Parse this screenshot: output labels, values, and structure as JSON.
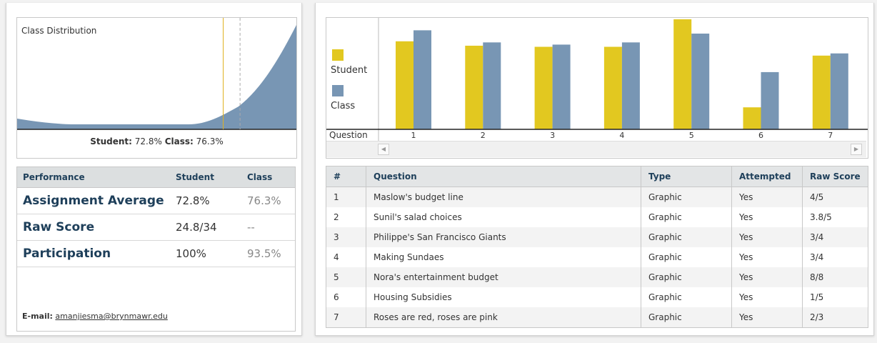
{
  "distribution": {
    "title": "Class Distribution",
    "student_label": "Student:",
    "student_value": "72.8%",
    "class_label": "Class:",
    "class_value": "76.3%",
    "student_line_pct": 72.8,
    "class_line_pct": 76.3,
    "fill_color": "#7896b4",
    "student_line_color": "#e0b020"
  },
  "performance": {
    "headers": [
      "Performance",
      "Student",
      "Class"
    ],
    "rows": [
      {
        "label": "Assignment Average",
        "student": "72.8%",
        "class": "76.3%"
      },
      {
        "label": "Raw Score",
        "student": "24.8/34",
        "class": "--"
      },
      {
        "label": "Participation",
        "student": "100%",
        "class": "93.5%"
      }
    ]
  },
  "email": {
    "label": "E-mail:",
    "address": "amanjiesma@brynmawr.edu"
  },
  "chart_data": {
    "type": "bar",
    "categories": [
      "1",
      "2",
      "3",
      "4",
      "5",
      "6",
      "7"
    ],
    "series": [
      {
        "name": "Student",
        "values": [
          0.8,
          0.76,
          0.75,
          0.75,
          1.0,
          0.2,
          0.67
        ],
        "color": "#e2c820"
      },
      {
        "name": "Class",
        "values": [
          0.9,
          0.79,
          0.77,
          0.79,
          0.87,
          0.52,
          0.69
        ],
        "color": "#7896b4"
      }
    ],
    "xlabel": "Question",
    "ylim": [
      0,
      1
    ]
  },
  "questions": {
    "headers": [
      "#",
      "Question",
      "Type",
      "Attempted",
      "Raw Score"
    ],
    "rows": [
      {
        "num": "1",
        "question": "Maslow's budget line",
        "type": "Graphic",
        "attempted": "Yes",
        "score": "4/5"
      },
      {
        "num": "2",
        "question": "Sunil's salad choices",
        "type": "Graphic",
        "attempted": "Yes",
        "score": "3.8/5"
      },
      {
        "num": "3",
        "question": "Philippe's San Francisco Giants",
        "type": "Graphic",
        "attempted": "Yes",
        "score": "3/4"
      },
      {
        "num": "4",
        "question": "Making Sundaes",
        "type": "Graphic",
        "attempted": "Yes",
        "score": "3/4"
      },
      {
        "num": "5",
        "question": "Nora's entertainment budget",
        "type": "Graphic",
        "attempted": "Yes",
        "score": "8/8"
      },
      {
        "num": "6",
        "question": "Housing Subsidies",
        "type": "Graphic",
        "attempted": "Yes",
        "score": "1/5"
      },
      {
        "num": "7",
        "question": "Roses are red, roses are pink",
        "type": "Graphic",
        "attempted": "Yes",
        "score": "2/3"
      }
    ]
  },
  "icons": {
    "scroll_left": "◀",
    "scroll_right": "▶"
  }
}
